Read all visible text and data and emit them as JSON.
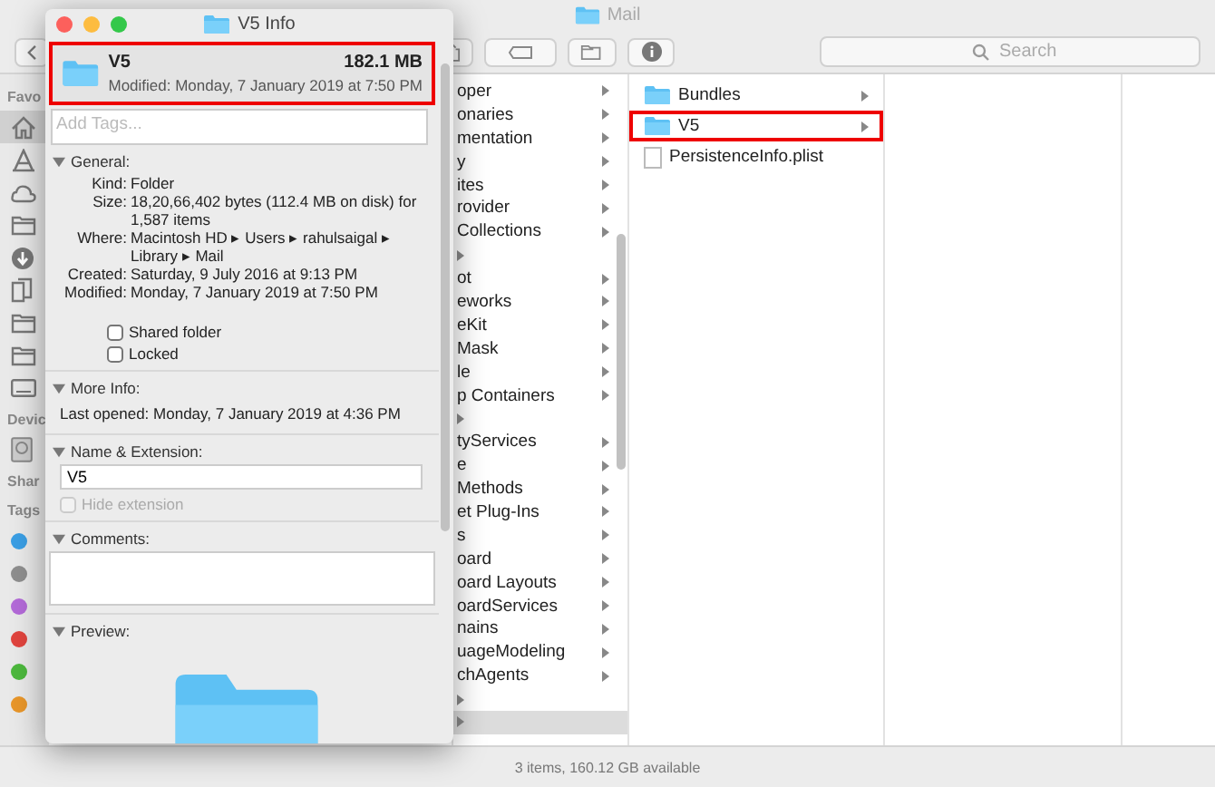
{
  "finder": {
    "title": "Mail",
    "search": {
      "placeholder": "Search"
    },
    "sidebar": [
      {
        "label": "Favo",
        "items": [
          {
            "kind": "home",
            "selected": true
          },
          {
            "kind": "apps",
            "selected": false
          },
          {
            "kind": "cloud",
            "selected": false
          },
          {
            "kind": "folder",
            "selected": false
          },
          {
            "kind": "download",
            "selected": false
          },
          {
            "kind": "documents",
            "selected": false
          },
          {
            "kind": "folder",
            "selected": false
          },
          {
            "kind": "folder",
            "selected": false
          },
          {
            "kind": "keyboard",
            "selected": false
          }
        ]
      },
      {
        "label": "Devic",
        "items": [
          {
            "kind": "drive",
            "selected": false
          }
        ]
      },
      {
        "label": "Shar"
      },
      {
        "label": "Tags",
        "items": [
          {
            "kind": "tag",
            "color": "#3a9ee4"
          },
          {
            "kind": "tag",
            "color": "#8e8e8e"
          },
          {
            "kind": "tag",
            "color": "#b36ad8"
          },
          {
            "kind": "tag",
            "color": "#e0443e"
          },
          {
            "kind": "tag",
            "color": "#4cb83d"
          },
          {
            "kind": "tag",
            "color": "#e8962a"
          }
        ]
      }
    ],
    "column_1": [
      {
        "name": "oper",
        "selected": false
      },
      {
        "name": "onaries",
        "selected": false
      },
      {
        "name": "mentation",
        "selected": false
      },
      {
        "name": "y",
        "selected": false
      },
      {
        "name": "ites",
        "selected": false
      },
      {
        "name": "rovider",
        "selected": false
      },
      {
        "name": "Collections",
        "selected": false
      },
      {
        "selected": false
      },
      {
        "name": "ot",
        "selected": false
      },
      {
        "name": "eworks",
        "selected": false
      },
      {
        "name": "eKit",
        "selected": false
      },
      {
        "name": "Mask",
        "selected": false
      },
      {
        "name": "le",
        "selected": false
      },
      {
        "name": "p Containers",
        "selected": false
      },
      {
        "selected": false
      },
      {
        "name": "tyServices",
        "selected": false
      },
      {
        "name": "e",
        "selected": false
      },
      {
        "name": "Methods",
        "selected": false
      },
      {
        "name": "et Plug-Ins",
        "selected": false
      },
      {
        "name": "s",
        "selected": false
      },
      {
        "name": "oard",
        "selected": false
      },
      {
        "name": "oard Layouts",
        "selected": false
      },
      {
        "name": "oardServices",
        "selected": false
      },
      {
        "name": "nains",
        "selected": false
      },
      {
        "name": "uageModeling",
        "selected": false
      },
      {
        "name": "chAgents",
        "selected": false
      },
      {
        "selected": false
      },
      {
        "selected": true
      }
    ],
    "column_2": [
      {
        "name": "Bundles",
        "kind": "folder",
        "annotated": false
      },
      {
        "name": "V5",
        "kind": "folder",
        "annotated": true
      },
      {
        "name": "PersistenceInfo.plist",
        "kind": "file",
        "annotated": false
      }
    ],
    "status_bar": "3 items, 160.12 GB available"
  },
  "info_window": {
    "title": "V5 Info",
    "header": {
      "name": "V5",
      "size": "182.1 MB",
      "modified": "Modified: Monday, 7 January 2019 at 7:50 PM",
      "annotated": true
    },
    "tags": {
      "placeholder": "Add Tags..."
    },
    "sections": [
      {
        "kind": "general",
        "title": "General:",
        "expanded": true,
        "fields": [
          {
            "label": "Kind:",
            "value": "Folder"
          },
          {
            "label": "Size:",
            "value": "18,20,66,402 bytes (112.4 MB on disk) for 1,587 items"
          },
          {
            "label": "Where:",
            "value": "Macintosh HD ▸ Users ▸ rahulsaigal ▸ Library ▸ Mail"
          },
          {
            "label": "Created:",
            "value": "Saturday, 9 July 2016 at 9:13 PM"
          },
          {
            "label": "Modified:",
            "value": "Monday, 7 January 2019 at 7:50 PM"
          }
        ],
        "checkboxes": [
          {
            "label": "Shared folder",
            "checked": false,
            "disabled": false
          },
          {
            "label": "Locked",
            "checked": false,
            "disabled": false
          }
        ]
      },
      {
        "kind": "more_info",
        "title": "More Info:",
        "expanded": true,
        "fields": [
          {
            "label": "Last opened:",
            "value": "Monday, 7 January 2019 at 4:36 PM"
          }
        ]
      },
      {
        "kind": "name_extension",
        "title": "Name & Extension:",
        "expanded": true,
        "value": "V5",
        "checkboxes": [
          {
            "label": "Hide extension",
            "checked": false,
            "disabled": true
          }
        ]
      },
      {
        "kind": "comments",
        "title": "Comments:",
        "expanded": true
      },
      {
        "kind": "preview",
        "title": "Preview:",
        "expanded": true
      }
    ]
  }
}
